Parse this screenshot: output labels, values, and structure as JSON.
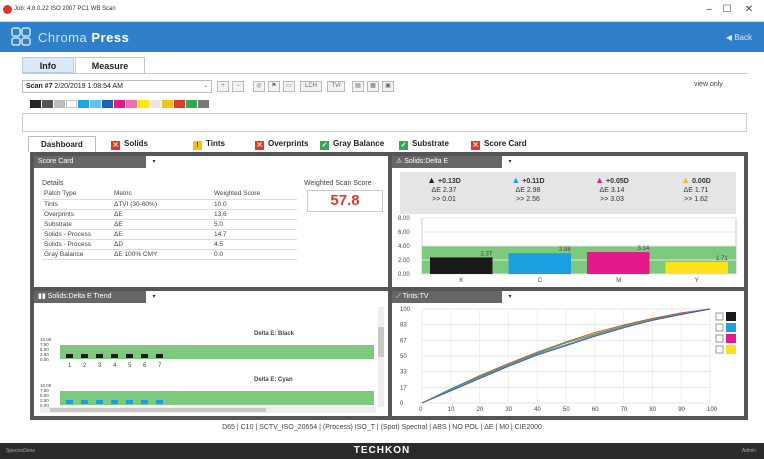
{
  "window": {
    "title": "Job: 4.8.0.22 ISO 2007 PC1 WB Scan",
    "minimize": "–",
    "maximize": "☐",
    "close": "✕"
  },
  "header": {
    "brand_light": "Chroma",
    "brand_bold": "Press",
    "back_label": "Back",
    "back_icon": "◀",
    "color": "#2f80c9"
  },
  "main_tabs": [
    "Info",
    "Measure"
  ],
  "toolbar": {
    "scan_label": "Scan #7",
    "scan_date": "2/20/2019 1:08:54 AM",
    "buttons": [
      "LCH",
      "TVI"
    ],
    "view_only": "view only"
  },
  "swatches": [
    "#222222",
    "#555555",
    "#bdbdbd",
    "#ffffff",
    "#1fa3e0",
    "#5fc3ee",
    "#1e63b8",
    "#e6198c",
    "#f06fb4",
    "#ffe600",
    "#e6e6e6",
    "#f2c319",
    "#e03a2d",
    "#34a853",
    "#7a7a7a"
  ],
  "sub_tabs": [
    {
      "label": "Dashboard",
      "icon": "",
      "color": ""
    },
    {
      "label": "Solids",
      "icon": "✕",
      "color": "#e03a2d"
    },
    {
      "label": "Tints",
      "icon": "!",
      "color": "#f4c20d"
    },
    {
      "label": "Overprints",
      "icon": "✕",
      "color": "#e03a2d"
    },
    {
      "label": "Gray Balance",
      "icon": "✓",
      "color": "#3aa655"
    },
    {
      "label": "Substrate",
      "icon": "✓",
      "color": "#3aa655"
    },
    {
      "label": "Score Card",
      "icon": "✕",
      "color": "#e03a2d"
    }
  ],
  "score_card": {
    "title": "Score Card",
    "details_label": "Details",
    "headers": [
      "Patch Type",
      "Metric",
      "Weighted Score"
    ],
    "rows": [
      [
        "Tints",
        "ΔTVI (30-60%)",
        "10.0"
      ],
      [
        "Overprints",
        "ΔE",
        "13.6"
      ],
      [
        "Substrate",
        "ΔE",
        "5.0"
      ],
      [
        "Solids - Process",
        "ΔE",
        "14.7"
      ],
      [
        "Solids - Process",
        "ΔD",
        "4.5"
      ],
      [
        "Gray Balance",
        "ΔE 100% CMY",
        "0.0"
      ]
    ],
    "weighted_label": "Weighted Scan Score",
    "weighted_value": "57.8"
  },
  "solids_delta_e": {
    "title": "Solids:Delta E",
    "inks": [
      {
        "name": "K",
        "delta_d": "+0.13D",
        "de": "ΔE 2.37",
        "sub": ">> 0.01",
        "color": "#1a1a1a",
        "warn": "#222"
      },
      {
        "name": "C",
        "delta_d": "+0.11D",
        "de": "ΔE 2.98",
        "sub": ">> 2.56",
        "color": "#1ba1e2",
        "warn": "#1ba1e2"
      },
      {
        "name": "M",
        "delta_d": "+0.05D",
        "de": "ΔE 3.14",
        "sub": ">> 3.03",
        "color": "#e6198c",
        "warn": "#e6198c"
      },
      {
        "name": "Y",
        "delta_d": "0.00D",
        "de": "ΔE 1.71",
        "sub": ">> 1.62",
        "color": "#ffe21a",
        "warn": "#f4c20d"
      }
    ]
  },
  "trend": {
    "title": "Solids:Delta E Trend",
    "charts": [
      {
        "title": "Delta E: Black",
        "yticks": [
          "10.00",
          "7.50",
          "5.00",
          "2.50",
          "0.00"
        ],
        "xticks": [
          "1",
          "2",
          "3",
          "4",
          "5",
          "6",
          "7"
        ],
        "color": "#1a1a1a"
      },
      {
        "title": "Delta E: Cyan",
        "yticks": [
          "10.00",
          "7.50",
          "5.00",
          "2.50",
          "0.00"
        ],
        "xticks": [],
        "color": "#1ba1e2"
      }
    ]
  },
  "tints_tv": {
    "title": "Tints:TV",
    "legend": [
      "#1a1a1a",
      "#1ba1e2",
      "#e6198c",
      "#ffe21a"
    ]
  },
  "chart_data": [
    {
      "type": "bar",
      "title": "Solids:Delta E",
      "categories": [
        "K",
        "C",
        "M",
        "Y"
      ],
      "values": [
        2.37,
        2.98,
        3.14,
        1.71
      ],
      "yticks": [
        "8.00",
        "6.00",
        "4.00",
        "2.00",
        "0.00"
      ],
      "ylim": [
        0,
        8
      ]
    },
    {
      "type": "line",
      "title": "Tints:TV",
      "x": [
        0,
        10,
        20,
        30,
        40,
        50,
        60,
        70,
        80,
        90,
        100
      ],
      "xlim": [
        0,
        100
      ],
      "ylim": [
        0,
        100
      ],
      "yticks": [
        "100",
        "83",
        "67",
        "50",
        "33",
        "17",
        "0"
      ],
      "xticks": [
        "0",
        "10",
        "20",
        "30",
        "40",
        "50",
        "60",
        "70",
        "80",
        "90",
        "100"
      ],
      "series": [
        {
          "values": [
            0,
            15,
            29,
            42,
            54,
            65,
            75,
            83,
            90,
            96,
            100
          ]
        },
        {
          "values": [
            0,
            14,
            28,
            41,
            53,
            64,
            74,
            82,
            89,
            95,
            100
          ]
        },
        {
          "values": [
            0,
            15,
            28,
            41,
            53,
            64,
            73,
            82,
            89,
            95,
            100
          ]
        },
        {
          "values": [
            0,
            14,
            27,
            40,
            52,
            62,
            72,
            81,
            88,
            95,
            100
          ]
        },
        {
          "values": [
            0,
            13,
            26,
            39,
            51,
            61,
            71,
            80,
            88,
            94,
            100
          ]
        }
      ]
    }
  ],
  "footer": {
    "status": "D65 | C10 | SCTV_ISO_20654 | (Process) ISO_T | (Spot) Spectral | ABS | NO POL | ΔE | M0 | CIE2000",
    "brand": "TECHKON",
    "left": "SpectroDens",
    "right": "Admin"
  }
}
